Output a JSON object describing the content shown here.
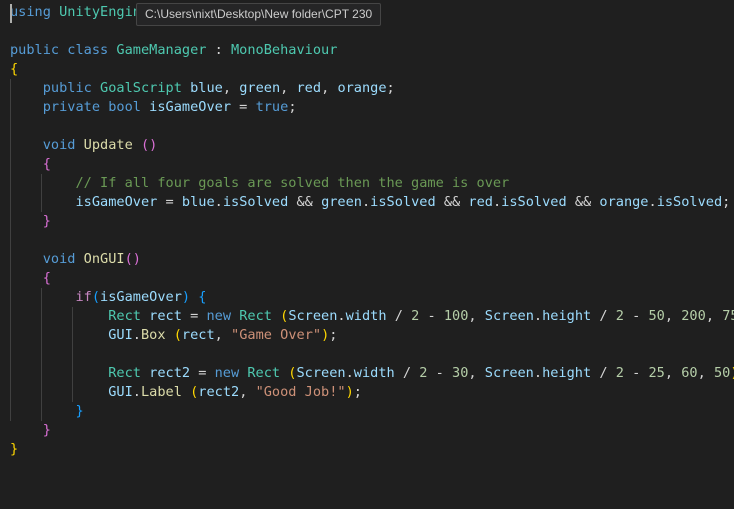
{
  "tooltip": {
    "path": "C:\\Users\\nixt\\Desktop\\New folder\\CPT 230"
  },
  "colors": {
    "keyword_blue": "#569cd6",
    "keyword_purple": "#c586c0",
    "type_teal": "#4ec9b0",
    "identifier": "#9cdcfe",
    "function": "#dcdcaa",
    "string": "#ce9178",
    "number": "#b5cea8",
    "comment": "#6a9955",
    "text": "#d4d4d4",
    "bracket_gold": "#ffd700",
    "bracket_pink": "#da70d6",
    "bracket_blue": "#179fff"
  },
  "code": [
    [
      [
        "using ",
        "#569cd6"
      ],
      [
        "UnityEngine",
        "#4ec9b0"
      ]
    ],
    [],
    [
      [
        "public ",
        "#569cd6"
      ],
      [
        "class ",
        "#569cd6"
      ],
      [
        "GameManager",
        "#4ec9b0"
      ],
      [
        " : ",
        "#d4d4d4"
      ],
      [
        "MonoBehaviour",
        "#4ec9b0"
      ]
    ],
    [
      [
        "{",
        "#ffd700"
      ]
    ],
    [
      [
        "    ",
        "#d4d4d4"
      ],
      [
        "public ",
        "#569cd6"
      ],
      [
        "GoalScript ",
        "#4ec9b0"
      ],
      [
        "blue",
        "#9cdcfe"
      ],
      [
        ", ",
        "#d4d4d4"
      ],
      [
        "green",
        "#9cdcfe"
      ],
      [
        ", ",
        "#d4d4d4"
      ],
      [
        "red",
        "#9cdcfe"
      ],
      [
        ", ",
        "#d4d4d4"
      ],
      [
        "orange",
        "#9cdcfe"
      ],
      [
        ";",
        "#d4d4d4"
      ]
    ],
    [
      [
        "    ",
        "#d4d4d4"
      ],
      [
        "private ",
        "#569cd6"
      ],
      [
        "bool ",
        "#569cd6"
      ],
      [
        "isGameOver",
        "#9cdcfe"
      ],
      [
        " = ",
        "#d4d4d4"
      ],
      [
        "true",
        "#569cd6"
      ],
      [
        ";",
        "#d4d4d4"
      ]
    ],
    [],
    [
      [
        "    ",
        "#d4d4d4"
      ],
      [
        "void ",
        "#569cd6"
      ],
      [
        "Update",
        "#dcdcaa"
      ],
      [
        " ",
        "#d4d4d4"
      ],
      [
        "()",
        "#da70d6"
      ]
    ],
    [
      [
        "    ",
        "#d4d4d4"
      ],
      [
        "{",
        "#da70d6"
      ]
    ],
    [
      [
        "        ",
        "#d4d4d4"
      ],
      [
        "// If all four goals are solved then the game is over",
        "#6a9955"
      ]
    ],
    [
      [
        "        ",
        "#d4d4d4"
      ],
      [
        "isGameOver",
        "#9cdcfe"
      ],
      [
        " = ",
        "#d4d4d4"
      ],
      [
        "blue",
        "#9cdcfe"
      ],
      [
        ".",
        "#d4d4d4"
      ],
      [
        "isSolved",
        "#9cdcfe"
      ],
      [
        " && ",
        "#d4d4d4"
      ],
      [
        "green",
        "#9cdcfe"
      ],
      [
        ".",
        "#d4d4d4"
      ],
      [
        "isSolved",
        "#9cdcfe"
      ],
      [
        " && ",
        "#d4d4d4"
      ],
      [
        "red",
        "#9cdcfe"
      ],
      [
        ".",
        "#d4d4d4"
      ],
      [
        "isSolved",
        "#9cdcfe"
      ],
      [
        " && ",
        "#d4d4d4"
      ],
      [
        "orange",
        "#9cdcfe"
      ],
      [
        ".",
        "#d4d4d4"
      ],
      [
        "isSolved",
        "#9cdcfe"
      ],
      [
        ";",
        "#d4d4d4"
      ]
    ],
    [
      [
        "    ",
        "#d4d4d4"
      ],
      [
        "}",
        "#da70d6"
      ]
    ],
    [],
    [
      [
        "    ",
        "#d4d4d4"
      ],
      [
        "void ",
        "#569cd6"
      ],
      [
        "OnGUI",
        "#dcdcaa"
      ],
      [
        "()",
        "#da70d6"
      ]
    ],
    [
      [
        "    ",
        "#d4d4d4"
      ],
      [
        "{",
        "#da70d6"
      ]
    ],
    [
      [
        "        ",
        "#d4d4d4"
      ],
      [
        "if",
        "#c586c0"
      ],
      [
        "(",
        "#179fff"
      ],
      [
        "isGameOver",
        "#9cdcfe"
      ],
      [
        ")",
        "#179fff"
      ],
      [
        " ",
        "#d4d4d4"
      ],
      [
        "{",
        "#179fff"
      ]
    ],
    [
      [
        "            ",
        "#d4d4d4"
      ],
      [
        "Rect ",
        "#4ec9b0"
      ],
      [
        "rect",
        "#9cdcfe"
      ],
      [
        " = ",
        "#d4d4d4"
      ],
      [
        "new ",
        "#569cd6"
      ],
      [
        "Rect ",
        "#4ec9b0"
      ],
      [
        "(",
        "#ffd700"
      ],
      [
        "Screen",
        "#9cdcfe"
      ],
      [
        ".",
        "#d4d4d4"
      ],
      [
        "width",
        "#9cdcfe"
      ],
      [
        " / ",
        "#d4d4d4"
      ],
      [
        "2",
        "#b5cea8"
      ],
      [
        " - ",
        "#d4d4d4"
      ],
      [
        "100",
        "#b5cea8"
      ],
      [
        ", ",
        "#d4d4d4"
      ],
      [
        "Screen",
        "#9cdcfe"
      ],
      [
        ".",
        "#d4d4d4"
      ],
      [
        "height",
        "#9cdcfe"
      ],
      [
        " / ",
        "#d4d4d4"
      ],
      [
        "2",
        "#b5cea8"
      ],
      [
        " - ",
        "#d4d4d4"
      ],
      [
        "50",
        "#b5cea8"
      ],
      [
        ", ",
        "#d4d4d4"
      ],
      [
        "200",
        "#b5cea8"
      ],
      [
        ", ",
        "#d4d4d4"
      ],
      [
        "75",
        "#b5cea8"
      ],
      [
        ")",
        "#ffd700"
      ],
      [
        ";",
        "#d4d4d4"
      ]
    ],
    [
      [
        "            ",
        "#d4d4d4"
      ],
      [
        "GUI",
        "#9cdcfe"
      ],
      [
        ".",
        "#d4d4d4"
      ],
      [
        "Box",
        "#dcdcaa"
      ],
      [
        " ",
        "#d4d4d4"
      ],
      [
        "(",
        "#ffd700"
      ],
      [
        "rect",
        "#9cdcfe"
      ],
      [
        ", ",
        "#d4d4d4"
      ],
      [
        "\"Game Over\"",
        "#ce9178"
      ],
      [
        ")",
        "#ffd700"
      ],
      [
        ";",
        "#d4d4d4"
      ]
    ],
    [],
    [
      [
        "            ",
        "#d4d4d4"
      ],
      [
        "Rect ",
        "#4ec9b0"
      ],
      [
        "rect2",
        "#9cdcfe"
      ],
      [
        " = ",
        "#d4d4d4"
      ],
      [
        "new ",
        "#569cd6"
      ],
      [
        "Rect ",
        "#4ec9b0"
      ],
      [
        "(",
        "#ffd700"
      ],
      [
        "Screen",
        "#9cdcfe"
      ],
      [
        ".",
        "#d4d4d4"
      ],
      [
        "width",
        "#9cdcfe"
      ],
      [
        " / ",
        "#d4d4d4"
      ],
      [
        "2",
        "#b5cea8"
      ],
      [
        " - ",
        "#d4d4d4"
      ],
      [
        "30",
        "#b5cea8"
      ],
      [
        ", ",
        "#d4d4d4"
      ],
      [
        "Screen",
        "#9cdcfe"
      ],
      [
        ".",
        "#d4d4d4"
      ],
      [
        "height",
        "#9cdcfe"
      ],
      [
        " / ",
        "#d4d4d4"
      ],
      [
        "2",
        "#b5cea8"
      ],
      [
        " - ",
        "#d4d4d4"
      ],
      [
        "25",
        "#b5cea8"
      ],
      [
        ", ",
        "#d4d4d4"
      ],
      [
        "60",
        "#b5cea8"
      ],
      [
        ", ",
        "#d4d4d4"
      ],
      [
        "50",
        "#b5cea8"
      ],
      [
        ")",
        "#ffd700"
      ],
      [
        ";",
        "#d4d4d4"
      ]
    ],
    [
      [
        "            ",
        "#d4d4d4"
      ],
      [
        "GUI",
        "#9cdcfe"
      ],
      [
        ".",
        "#d4d4d4"
      ],
      [
        "Label",
        "#dcdcaa"
      ],
      [
        " ",
        "#d4d4d4"
      ],
      [
        "(",
        "#ffd700"
      ],
      [
        "rect2",
        "#9cdcfe"
      ],
      [
        ", ",
        "#d4d4d4"
      ],
      [
        "\"Good Job!\"",
        "#ce9178"
      ],
      [
        ")",
        "#ffd700"
      ],
      [
        ";",
        "#d4d4d4"
      ]
    ],
    [
      [
        "        ",
        "#d4d4d4"
      ],
      [
        "}",
        "#179fff"
      ]
    ],
    [
      [
        "    ",
        "#d4d4d4"
      ],
      [
        "}",
        "#da70d6"
      ]
    ],
    [
      [
        "}",
        "#ffd700"
      ]
    ]
  ]
}
